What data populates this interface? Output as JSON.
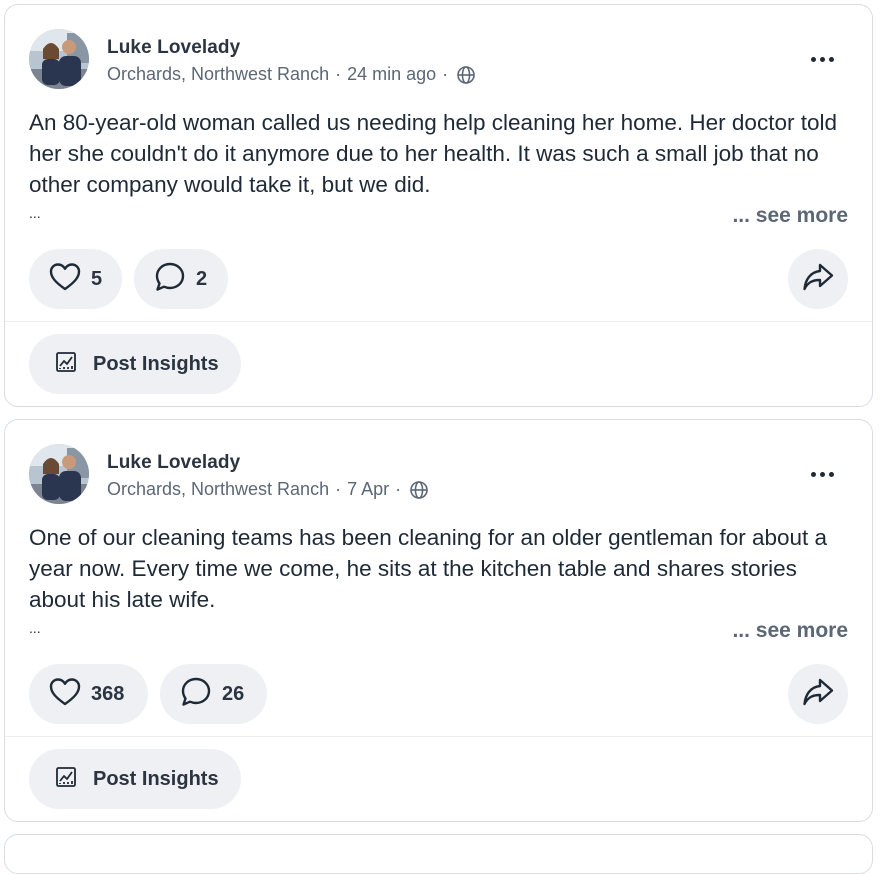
{
  "posts": [
    {
      "author": "Luke Lovelady",
      "location": "Orchards, Northwest Ranch",
      "time": "24 min ago",
      "text": "An 80-year-old woman called us needing help cleaning her home. Her doctor told her she couldn't do it anymore due to her health. It was such a small job that no other company would take it, but we did.",
      "ellipsis": "...",
      "see_more": "... see more",
      "likes": "5",
      "comments": "2",
      "insights_label": "Post Insights"
    },
    {
      "author": "Luke Lovelady",
      "location": "Orchards, Northwest Ranch",
      "time": "7 Apr",
      "text": "One of our cleaning teams has been cleaning for an older gentleman for about a year now. Every time we come, he sits at the kitchen table and shares stories about his late wife.",
      "ellipsis": "...",
      "see_more": "... see more",
      "likes": "368",
      "comments": "26",
      "insights_label": "Post Insights"
    }
  ],
  "meta_separator": "·",
  "icons": {
    "visibility": "globe-icon",
    "more": "more-horizontal-icon",
    "like": "heart-icon",
    "comment": "comment-bubble-icon",
    "share": "share-arrow-icon",
    "insights": "chart-icon"
  },
  "colors": {
    "pill_bg": "#eef0f3",
    "text": "#1f2a37",
    "muted": "#5c6776",
    "border": "#d9dde3"
  }
}
